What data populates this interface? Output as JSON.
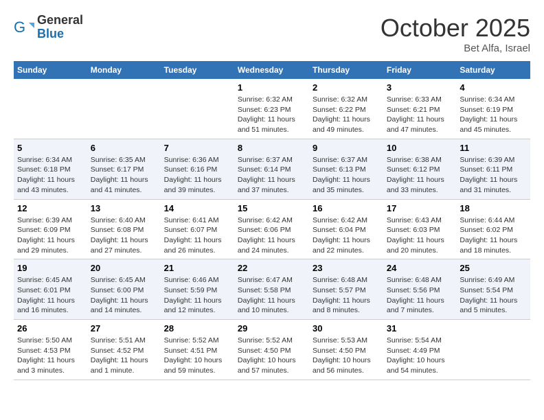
{
  "header": {
    "logo_general": "General",
    "logo_blue": "Blue",
    "month_title": "October 2025",
    "location": "Bet Alfa, Israel"
  },
  "weekdays": [
    "Sunday",
    "Monday",
    "Tuesday",
    "Wednesday",
    "Thursday",
    "Friday",
    "Saturday"
  ],
  "weeks": [
    [
      {
        "day": "",
        "info": ""
      },
      {
        "day": "",
        "info": ""
      },
      {
        "day": "",
        "info": ""
      },
      {
        "day": "1",
        "info": "Sunrise: 6:32 AM\nSunset: 6:23 PM\nDaylight: 11 hours and 51 minutes."
      },
      {
        "day": "2",
        "info": "Sunrise: 6:32 AM\nSunset: 6:22 PM\nDaylight: 11 hours and 49 minutes."
      },
      {
        "day": "3",
        "info": "Sunrise: 6:33 AM\nSunset: 6:21 PM\nDaylight: 11 hours and 47 minutes."
      },
      {
        "day": "4",
        "info": "Sunrise: 6:34 AM\nSunset: 6:19 PM\nDaylight: 11 hours and 45 minutes."
      }
    ],
    [
      {
        "day": "5",
        "info": "Sunrise: 6:34 AM\nSunset: 6:18 PM\nDaylight: 11 hours and 43 minutes."
      },
      {
        "day": "6",
        "info": "Sunrise: 6:35 AM\nSunset: 6:17 PM\nDaylight: 11 hours and 41 minutes."
      },
      {
        "day": "7",
        "info": "Sunrise: 6:36 AM\nSunset: 6:16 PM\nDaylight: 11 hours and 39 minutes."
      },
      {
        "day": "8",
        "info": "Sunrise: 6:37 AM\nSunset: 6:14 PM\nDaylight: 11 hours and 37 minutes."
      },
      {
        "day": "9",
        "info": "Sunrise: 6:37 AM\nSunset: 6:13 PM\nDaylight: 11 hours and 35 minutes."
      },
      {
        "day": "10",
        "info": "Sunrise: 6:38 AM\nSunset: 6:12 PM\nDaylight: 11 hours and 33 minutes."
      },
      {
        "day": "11",
        "info": "Sunrise: 6:39 AM\nSunset: 6:11 PM\nDaylight: 11 hours and 31 minutes."
      }
    ],
    [
      {
        "day": "12",
        "info": "Sunrise: 6:39 AM\nSunset: 6:09 PM\nDaylight: 11 hours and 29 minutes."
      },
      {
        "day": "13",
        "info": "Sunrise: 6:40 AM\nSunset: 6:08 PM\nDaylight: 11 hours and 27 minutes."
      },
      {
        "day": "14",
        "info": "Sunrise: 6:41 AM\nSunset: 6:07 PM\nDaylight: 11 hours and 26 minutes."
      },
      {
        "day": "15",
        "info": "Sunrise: 6:42 AM\nSunset: 6:06 PM\nDaylight: 11 hours and 24 minutes."
      },
      {
        "day": "16",
        "info": "Sunrise: 6:42 AM\nSunset: 6:04 PM\nDaylight: 11 hours and 22 minutes."
      },
      {
        "day": "17",
        "info": "Sunrise: 6:43 AM\nSunset: 6:03 PM\nDaylight: 11 hours and 20 minutes."
      },
      {
        "day": "18",
        "info": "Sunrise: 6:44 AM\nSunset: 6:02 PM\nDaylight: 11 hours and 18 minutes."
      }
    ],
    [
      {
        "day": "19",
        "info": "Sunrise: 6:45 AM\nSunset: 6:01 PM\nDaylight: 11 hours and 16 minutes."
      },
      {
        "day": "20",
        "info": "Sunrise: 6:45 AM\nSunset: 6:00 PM\nDaylight: 11 hours and 14 minutes."
      },
      {
        "day": "21",
        "info": "Sunrise: 6:46 AM\nSunset: 5:59 PM\nDaylight: 11 hours and 12 minutes."
      },
      {
        "day": "22",
        "info": "Sunrise: 6:47 AM\nSunset: 5:58 PM\nDaylight: 11 hours and 10 minutes."
      },
      {
        "day": "23",
        "info": "Sunrise: 6:48 AM\nSunset: 5:57 PM\nDaylight: 11 hours and 8 minutes."
      },
      {
        "day": "24",
        "info": "Sunrise: 6:48 AM\nSunset: 5:56 PM\nDaylight: 11 hours and 7 minutes."
      },
      {
        "day": "25",
        "info": "Sunrise: 6:49 AM\nSunset: 5:54 PM\nDaylight: 11 hours and 5 minutes."
      }
    ],
    [
      {
        "day": "26",
        "info": "Sunrise: 5:50 AM\nSunset: 4:53 PM\nDaylight: 11 hours and 3 minutes."
      },
      {
        "day": "27",
        "info": "Sunrise: 5:51 AM\nSunset: 4:52 PM\nDaylight: 11 hours and 1 minute."
      },
      {
        "day": "28",
        "info": "Sunrise: 5:52 AM\nSunset: 4:51 PM\nDaylight: 10 hours and 59 minutes."
      },
      {
        "day": "29",
        "info": "Sunrise: 5:52 AM\nSunset: 4:50 PM\nDaylight: 10 hours and 57 minutes."
      },
      {
        "day": "30",
        "info": "Sunrise: 5:53 AM\nSunset: 4:50 PM\nDaylight: 10 hours and 56 minutes."
      },
      {
        "day": "31",
        "info": "Sunrise: 5:54 AM\nSunset: 4:49 PM\nDaylight: 10 hours and 54 minutes."
      },
      {
        "day": "",
        "info": ""
      }
    ]
  ]
}
